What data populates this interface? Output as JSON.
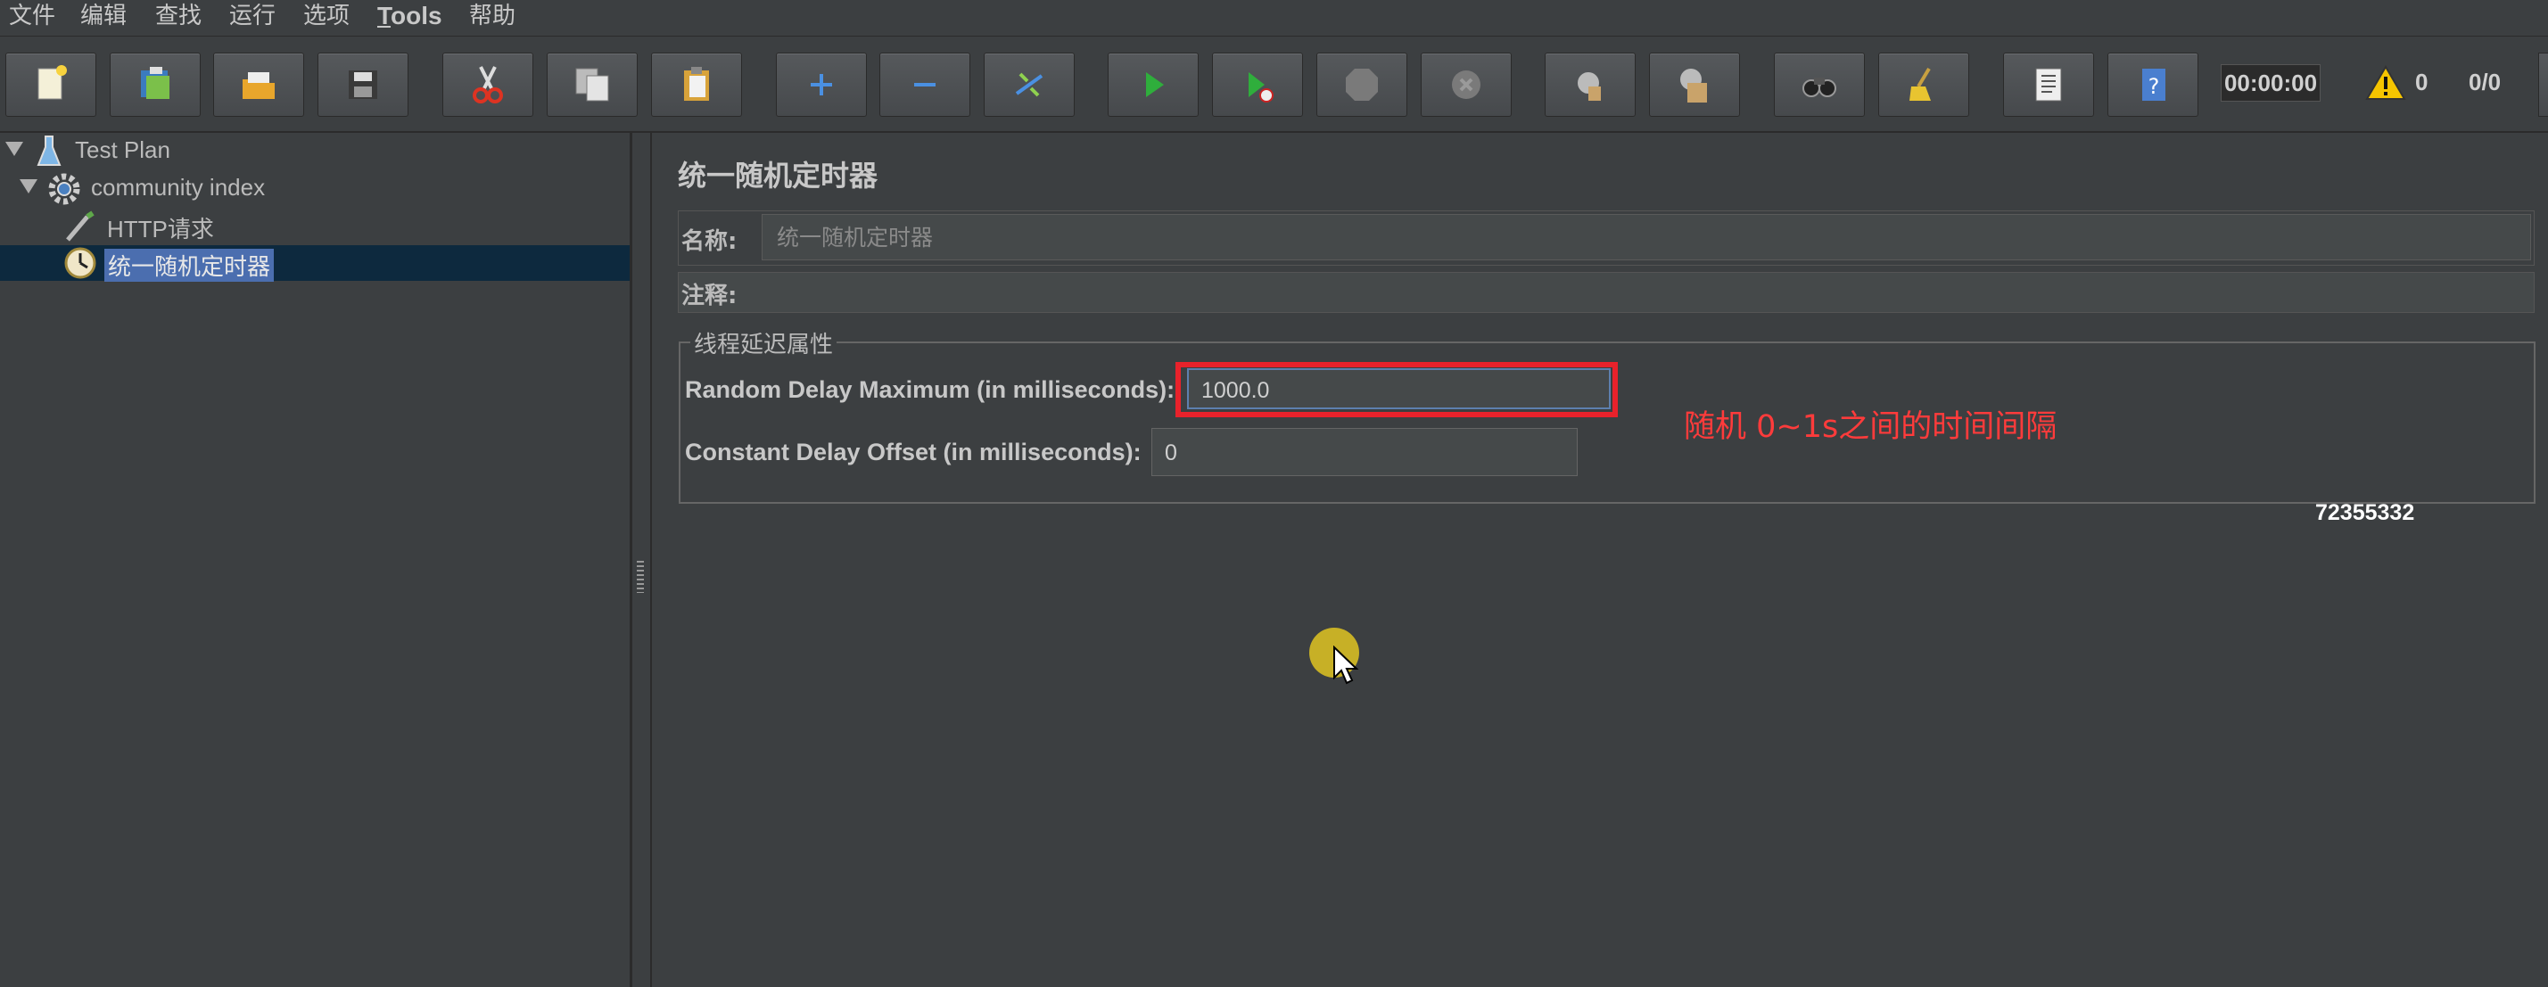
{
  "menu": {
    "items": [
      "文件",
      "编辑",
      "查找",
      "运行",
      "选项"
    ],
    "tools_underline": "T",
    "tools_rest": "ools",
    "help": "帮助"
  },
  "toolbar": {
    "timer": "00:00:00",
    "warning_count": "0",
    "thread_ratio": "0/0",
    "icons": [
      "new-icon",
      "templates-icon",
      "open-icon",
      "save-icon",
      "cut-icon",
      "copy-icon",
      "paste-icon",
      "expand-icon",
      "collapse-icon",
      "toggle-icon",
      "start-icon",
      "start-no-pause-icon",
      "stop-icon",
      "shutdown-icon",
      "clear-icon",
      "clear-all-icon",
      "search-icon",
      "reset-search-icon",
      "function-helper-icon",
      "help-icon"
    ]
  },
  "tree": {
    "nodes": [
      {
        "label": "Test Plan",
        "icon": "flask-icon"
      },
      {
        "label": "community index",
        "icon": "gear-icon"
      },
      {
        "label": "HTTP请求",
        "icon": "pipette-icon"
      },
      {
        "label": "统一随机定时器",
        "icon": "timer-icon"
      }
    ]
  },
  "panel": {
    "title": "统一随机定时器",
    "name_label": "名称:",
    "name_value": "统一随机定时器",
    "comment_label": "注释:",
    "fieldset_legend": "线程延迟属性",
    "random_delay_label": "Random Delay Maximum (in milliseconds):",
    "random_delay_value": "1000.0",
    "offset_label": "Constant Delay Offset (in milliseconds):",
    "offset_value": "0"
  },
  "annotation": "随机 0~1s之间的时间间隔",
  "watermark": "72355332",
  "colors": {
    "background": "#3c3f41",
    "selection": "#4b6eaf",
    "highlight": "#e8222b",
    "annotation": "#ff3b3b"
  }
}
